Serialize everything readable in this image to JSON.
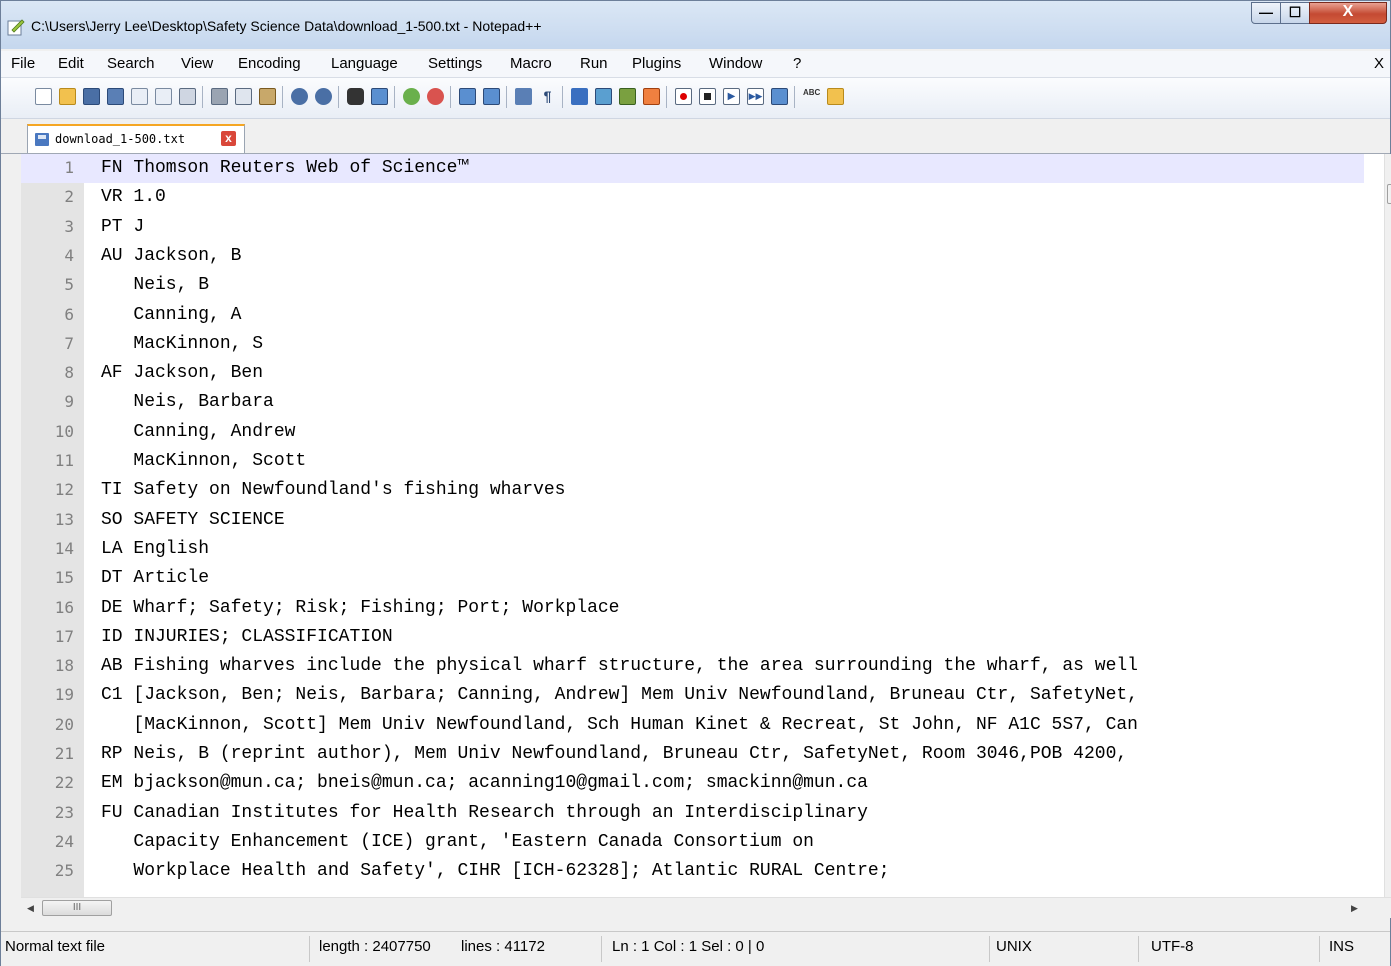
{
  "window": {
    "title": "C:\\Users\\Jerry Lee\\Desktop\\Safety Science Data\\download_1-500.txt - Notepad++",
    "minimize_glyph": "—",
    "maximize_glyph": "☐",
    "close_glyph": "X"
  },
  "menu": {
    "items": [
      "File",
      "Edit",
      "Search",
      "View",
      "Encoding",
      "Language",
      "Settings",
      "Macro",
      "Run",
      "Plugins",
      "Window",
      "?"
    ],
    "close_glyph": "X"
  },
  "toolbar": {
    "icons": [
      "new-file-icon",
      "open-file-icon",
      "save-icon",
      "save-all-icon",
      "close-icon",
      "close-all-icon",
      "print-icon",
      "cut-icon",
      "copy-icon",
      "paste-icon",
      "undo-icon",
      "redo-icon",
      "find-icon",
      "replace-icon",
      "zoom-in-icon",
      "zoom-out-icon",
      "sync-vertical-icon",
      "sync-horizontal-icon",
      "word-wrap-icon",
      "show-all-chars-icon",
      "indent-guide-icon",
      "doc-map-icon",
      "function-list-icon",
      "folder-workspace-icon",
      "record-macro-icon",
      "stop-macro-icon",
      "play-macro-icon",
      "run-macro-multiple-icon",
      "save-macro-icon",
      "spell-check-icon",
      "spell-check-options-icon"
    ]
  },
  "tab": {
    "label": "download_1-500.txt",
    "close_glyph": "x"
  },
  "editor": {
    "lines": [
      {
        "n": "1",
        "text": "FN Thomson Reuters Web of Science™"
      },
      {
        "n": "2",
        "text": "VR 1.0"
      },
      {
        "n": "3",
        "text": "PT J"
      },
      {
        "n": "4",
        "text": "AU Jackson, B"
      },
      {
        "n": "5",
        "text": "   Neis, B"
      },
      {
        "n": "6",
        "text": "   Canning, A"
      },
      {
        "n": "7",
        "text": "   MacKinnon, S"
      },
      {
        "n": "8",
        "text": "AF Jackson, Ben"
      },
      {
        "n": "9",
        "text": "   Neis, Barbara"
      },
      {
        "n": "10",
        "text": "   Canning, Andrew"
      },
      {
        "n": "11",
        "text": "   MacKinnon, Scott"
      },
      {
        "n": "12",
        "text": "TI Safety on Newfoundland's fishing wharves"
      },
      {
        "n": "13",
        "text": "SO SAFETY SCIENCE"
      },
      {
        "n": "14",
        "text": "LA English"
      },
      {
        "n": "15",
        "text": "DT Article"
      },
      {
        "n": "16",
        "text": "DE Wharf; Safety; Risk; Fishing; Port; Workplace"
      },
      {
        "n": "17",
        "text": "ID INJURIES; CLASSIFICATION"
      },
      {
        "n": "18",
        "text": "AB Fishing wharves include the physical wharf structure, the area surrounding the wharf, as well"
      },
      {
        "n": "19",
        "text": "C1 [Jackson, Ben; Neis, Barbara; Canning, Andrew] Mem Univ Newfoundland, Bruneau Ctr, SafetyNet,"
      },
      {
        "n": "20",
        "text": "   [MacKinnon, Scott] Mem Univ Newfoundland, Sch Human Kinet & Recreat, St John, NF A1C 5S7, Can"
      },
      {
        "n": "21",
        "text": "RP Neis, B (reprint author), Mem Univ Newfoundland, Bruneau Ctr, SafetyNet, Room 3046,POB 4200,"
      },
      {
        "n": "22",
        "text": "EM bjackson@mun.ca; bneis@mun.ca; acanning10@gmail.com; smackinn@mun.ca"
      },
      {
        "n": "23",
        "text": "FU Canadian Institutes for Health Research through an Interdisciplinary"
      },
      {
        "n": "24",
        "text": "   Capacity Enhancement (ICE) grant, 'Eastern Canada Consortium on"
      },
      {
        "n": "25",
        "text": "   Workplace Health and Safety', CIHR [ICH-62328]; Atlantic RURAL Centre;"
      }
    ]
  },
  "scroll": {
    "h_thumb_glyph": "III"
  },
  "status": {
    "file_type": "Normal text file",
    "length": "length : 2407750",
    "lines": "lines : 41172",
    "position": "Ln : 1    Col : 1    Sel : 0 | 0",
    "eol": "UNIX",
    "encoding": "UTF-8",
    "mode": "INS"
  },
  "colors": {
    "current_line": "#e8e8ff",
    "gutter": "#e4e4e4",
    "tab_accent": "#f5a623"
  }
}
